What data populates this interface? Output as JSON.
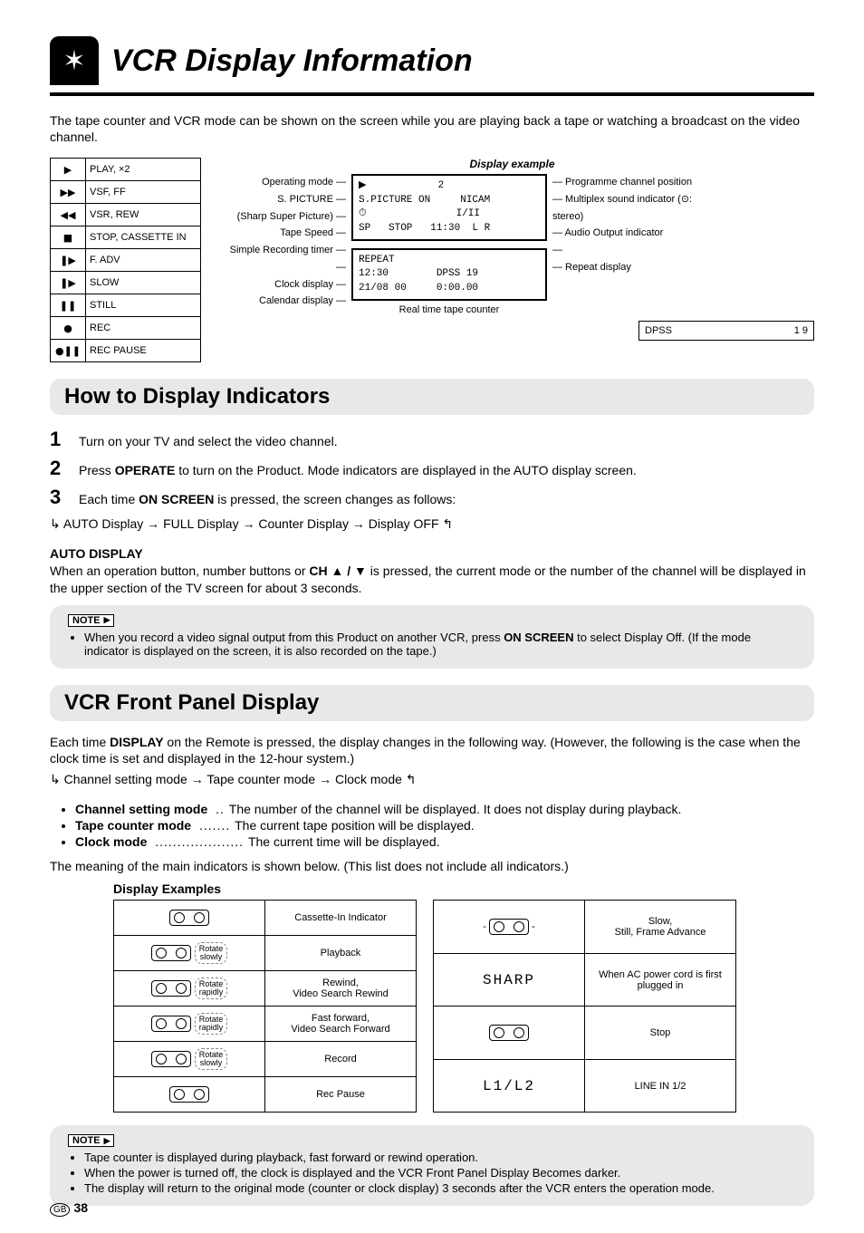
{
  "title": "VCR Display Information",
  "lead": "The tape counter and VCR mode can be shown on the screen while you are playing back a tape or watching a broadcast on the video channel.",
  "glyphs": [
    {
      "icon": "▶",
      "label": "PLAY, ×2"
    },
    {
      "icon": "▶▶",
      "label": "VSF, FF"
    },
    {
      "icon": "◀◀",
      "label": "VSR, REW"
    },
    {
      "icon": "■",
      "label": "STOP, CASSETTE IN"
    },
    {
      "icon": "❚▶",
      "label": "F. ADV"
    },
    {
      "icon": "❚▶",
      "label": "SLOW"
    },
    {
      "icon": "❚❚",
      "label": "STILL"
    },
    {
      "icon": "●",
      "label": "REC"
    },
    {
      "icon": "●❚❚",
      "label": "REC PAUSE"
    }
  ],
  "display": {
    "header": "Display example",
    "left_labels": [
      "Operating mode",
      "S. PICTURE",
      "(Sharp Super Picture)",
      "Tape Speed",
      "Simple Recording timer",
      "",
      "Clock display",
      "Calendar display"
    ],
    "right_labels": [
      "Programme channel position",
      "Multiplex sound indicator (⊙: stereo)",
      "Audio Output indicator",
      "",
      "Repeat display"
    ],
    "screen1_l1": "▶            2",
    "screen1_l2": "S.PICTURE ON     NICAM",
    "screen1_l3": "⏱               I/II",
    "screen1_l4": "SP   STOP   11:30  L R",
    "screen2_l1": "REPEAT",
    "screen2_l2": "12:30        DPSS 19",
    "screen2_l3": "21/08 00     0:00.00",
    "counter_caption": "Real time tape counter",
    "dpss_label": "DPSS",
    "dpss_value": "1 9"
  },
  "section_howto": "How to Display Indicators",
  "steps": {
    "s1": "Turn on your TV and select the video channel.",
    "s2_a": "Press ",
    "s2_b": "OPERATE",
    "s2_c": " to turn on the Product. Mode indicators are displayed in the AUTO display screen.",
    "s3_a": "Each time ",
    "s3_b": "ON SCREEN",
    "s3_c": " is pressed, the screen changes as follows:"
  },
  "flow1": "AUTO Display → FULL Display → Counter Display → Display OFF",
  "auto_title": "AUTO DISPLAY",
  "auto_body_a": "When an operation button, number buttons or ",
  "auto_body_b": "CH ▲ / ▼",
  "auto_body_c": " is pressed, the current mode or the number of the channel will be displayed in the upper section of the TV screen for about 3 seconds.",
  "note1_label": "NOTE",
  "note1_a": "When you record a video signal output from this Product on another VCR, press ",
  "note1_b": "ON SCREEN",
  "note1_c": " to select Display Off. (If the mode indicator is displayed on the screen, it is also recorded on the tape.)",
  "section_front": "VCR Front Panel Display",
  "front_intro_a": "Each time ",
  "front_intro_b": "DISPLAY",
  "front_intro_c": " on the Remote is pressed, the display changes in the following way. (However, the following is the case when the clock time is set and displayed in the 12-hour system.)",
  "flow2": "Channel setting mode → Tape counter mode → Clock mode",
  "modes": {
    "ch_t": "Channel setting mode",
    "ch_d": "The number of the channel will be displayed. It does not display during playback.",
    "tc_t": "Tape counter mode",
    "tc_d": "The current tape position will be displayed.",
    "cl_t": "Clock mode",
    "cl_d": "The current time will be displayed."
  },
  "meaning_line": "The meaning of the main indicators is shown below. (This list does not include all indicators.)",
  "examples_head": "Display Examples",
  "ex_left": [
    {
      "icon_style": "reel",
      "tag": "",
      "label": "Cassette-In Indicator"
    },
    {
      "icon_style": "reel",
      "tag": "Rotate slowly",
      "label": "Playback"
    },
    {
      "icon_style": "reel",
      "tag": "Rotate rapidly",
      "label": "Rewind, Video Search Rewind"
    },
    {
      "icon_style": "reel",
      "tag": "Rotate rapidly",
      "label": "Fast forward, Video Search Forward"
    },
    {
      "icon_style": "reel",
      "tag": "Rotate slowly",
      "label": "Record"
    },
    {
      "icon_style": "reel",
      "tag": "",
      "label": "Rec Pause"
    }
  ],
  "ex_right": [
    {
      "icon_style": "reel-blink",
      "label": "Slow, Still, Frame Advance"
    },
    {
      "icon_style": "seg",
      "text": "SHARP",
      "label": "When AC power cord is first plugged in"
    },
    {
      "icon_style": "reel",
      "label": "Stop"
    },
    {
      "icon_style": "seg",
      "text": "L1/L2",
      "label": "LINE IN 1/2"
    }
  ],
  "note2_items": [
    "Tape counter is displayed during playback, fast forward or rewind operation.",
    "When the power is turned off, the clock is displayed and the VCR Front Panel Display Becomes darker.",
    "The display will return to the original mode (counter or clock display) 3 seconds after the VCR enters the operation mode."
  ],
  "footer_gb": "GB",
  "footer_page": "38"
}
